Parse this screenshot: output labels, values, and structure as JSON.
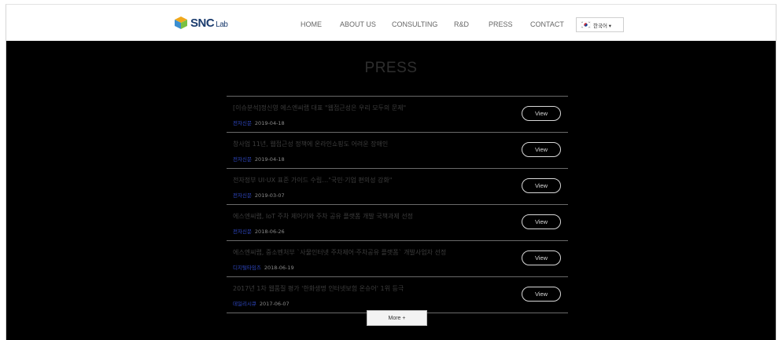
{
  "header": {
    "logo_text": "SNC",
    "logo_sub": "Lab",
    "nav": [
      "HOME",
      "ABOUT US",
      "CONSULTING",
      "R&D",
      "PRESS",
      "CONTACT"
    ],
    "language": "한국어 ▾"
  },
  "main": {
    "title": "PRESS",
    "items": [
      {
        "title": "[이슈분석]정신영 에스엔씨랩 대표 \"웹접근성은 우리 모두의 문제\"",
        "source": "전자신문",
        "date": "2019-04-18",
        "button": "View"
      },
      {
        "title": "창사업 11년, 웹접근성 정책에 온라인쇼핑도 어려운 장애인",
        "source": "전자신문",
        "date": "2019-04-18",
        "button": "View"
      },
      {
        "title": "전자정부 UI·UX 표준 가이드 수립…\"국민·기업 편의성 강화\"",
        "source": "전자신문",
        "date": "2019-03-07",
        "button": "View"
      },
      {
        "title": "에스엔씨랩, IoT 주차 제어기와 주차 공유 플랫폼 개발 국책과제 선정",
        "source": "전자신문",
        "date": "2018-06-26",
        "button": "View"
      },
      {
        "title": "에스엔씨랩, 중소벤처부 `사물인터넷 주차제어·주차공유 플랫폼` 개발사업자 선정",
        "source": "디지털타임즈",
        "date": "2018-06-19",
        "button": "View"
      },
      {
        "title": "2017년 1차 웹품질 평가 '한화생명 인터넷보험 온슈어' 1위 등극",
        "source": "데일리시큐",
        "date": "2017-06-07",
        "button": "View"
      }
    ],
    "more_label": "More +"
  }
}
